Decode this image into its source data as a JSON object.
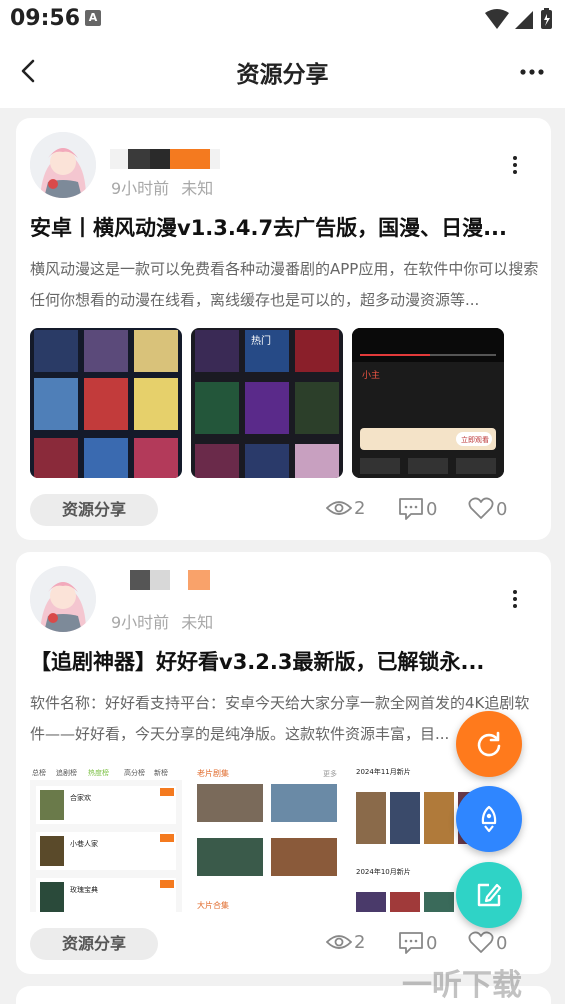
{
  "status_bar": {
    "time": "09:56",
    "notification_letter": "A"
  },
  "header": {
    "title": "资源分享"
  },
  "posts": [
    {
      "time_ago": "9小时前",
      "location": "未知",
      "title": "安卓丨横风动漫v1.3.4.7去广告版，国漫、日漫...",
      "description": "横风动漫这是一款可以免费看各种动漫番剧的APP应用，在软件中你可以搜索任何你想看的动漫在线看，离线缓存也是可以的，超多动漫资源等...",
      "tag": "资源分享",
      "views": "2",
      "comments": "0",
      "likes": "0"
    },
    {
      "time_ago": "9小时前",
      "location": "未知",
      "title": "【追剧神器】好好看v3.2.3最新版，已解锁永...",
      "description": "软件名称：好好看支持平台：安卓今天给大家分享一款全网首发的4K追剧软件——好好看，今天分享的是纯净版。这款软件资源丰富，目...",
      "tag": "资源分享",
      "views": "2",
      "comments": "0",
      "likes": "0"
    }
  ],
  "screenshot_texts": {
    "p1s2_label": "热门",
    "p1s3_label": "小主",
    "p1s3_button": "立即观看",
    "p2s1_tab1": "总榜",
    "p2s1_tab2": "追剧榜",
    "p2s1_tab3": "高分榜",
    "p2s1_active": "热度榜",
    "p2s1_tab5": "新榜",
    "p2s1_row1": "合家欢",
    "p2s1_row2": "小巷人家",
    "p2s1_row3": "玫瑰宝典",
    "p2s2_head": "老片剧集",
    "p2s2_more": "更多",
    "p2s2_foot": "大片合集",
    "p2s3_head1": "2024年11月新片",
    "p2s3_head2": "2024年10月新片"
  },
  "colors": {
    "fab_refresh": "#ff7a1c",
    "fab_rocket": "#2f86ff",
    "fab_edit": "#2fd3c6"
  },
  "watermark": "一听下载"
}
